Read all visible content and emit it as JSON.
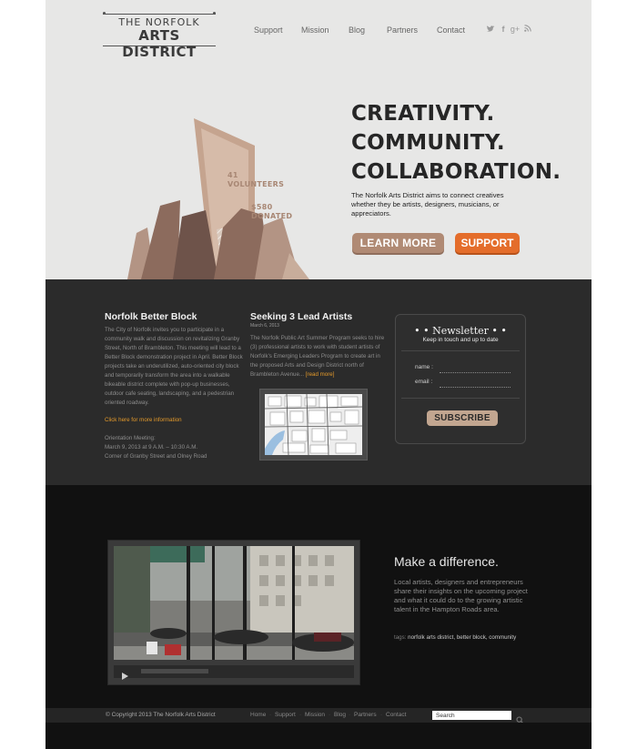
{
  "logo": {
    "line1": "THE NORFOLK",
    "line2": "ARTS DISTRICT"
  },
  "nav": {
    "items": [
      {
        "label": "Support"
      },
      {
        "label": "Mission"
      },
      {
        "label": "Blog"
      },
      {
        "label": "Partners"
      },
      {
        "label": "Contact"
      }
    ],
    "social": [
      {
        "icon": "twitter-icon"
      },
      {
        "icon": "facebook-icon",
        "label": "f"
      },
      {
        "icon": "google-plus-icon",
        "label": "g+"
      },
      {
        "icon": "rss-icon"
      }
    ]
  },
  "hero": {
    "headline": [
      "CREATIVITY.",
      "COMMUNITY.",
      "COLLABORATION."
    ],
    "description": "The Norfolk Arts District aims to connect creatives whether they be artists, designers, musicians, or appreciators.",
    "learn_more": "LEARN MORE",
    "support": "SUPPORT",
    "stat_volunteers_value": "41",
    "stat_volunteers_label": "VOLUNTEERS",
    "stat_donated_value": "$580",
    "stat_donated_label": "DONATED"
  },
  "news": {
    "post1": {
      "title": "Norfolk Better Block",
      "body": "The City of Norfolk invites you to participate in a community walk and discussion on revitalizing Granby Street, North of Brambleton. This meeting will lead to a Better Block demonstration project in April. Better Block projects take an underutilized, auto-oriented city block and temporarily transform the area into a walkable bikeable district complete with pop-up businesses, outdoor cafe seating, landscaping, and a pedestrian oriented roadway.",
      "link": "Click here for more information",
      "meeting_label": "Orientation Meeting:",
      "meeting_time": "March 9, 2013 at 9 A.M. – 10:30 A.M.",
      "meeting_place": "Corner of Granby Street and Olney Road"
    },
    "post2": {
      "title": "Seeking 3 Lead Artists",
      "date": "March 6, 2013",
      "body": "The Norfolk Public Art Summer Program seeks to hire (3) professional artists to work with student artists of Norfolk's Emerging Leaders Program to create art in the proposed Arts and Design District north of Brambleton Avenue...",
      "read_more": "[read more]"
    },
    "newsletter": {
      "title": "• • Newsletter • •",
      "subtitle": "Keep in touch and up to date",
      "name_label": "name :",
      "email_label": "email :",
      "subscribe": "SUBSCRIBE"
    }
  },
  "feature": {
    "title": "Make a difference.",
    "body": "Local artists, designers and entrepreneurs share their insights on the upcoming project and what it could do to the growing artistic talent in the Hampton Roads area.",
    "tags_label": "tags:",
    "tags": [
      "norfolk arts district",
      "better block",
      "community"
    ]
  },
  "footer": {
    "copyright": "© Copyright 2013 The Norfolk Arts District",
    "links": [
      "Home",
      "Support",
      "Mission",
      "Blog",
      "Partners",
      "Contact"
    ],
    "search_placeholder": "Search"
  },
  "colors": {
    "accent_orange": "#e46d2b",
    "accent_tan": "#b08a74",
    "link_orange": "#e49a2b"
  }
}
